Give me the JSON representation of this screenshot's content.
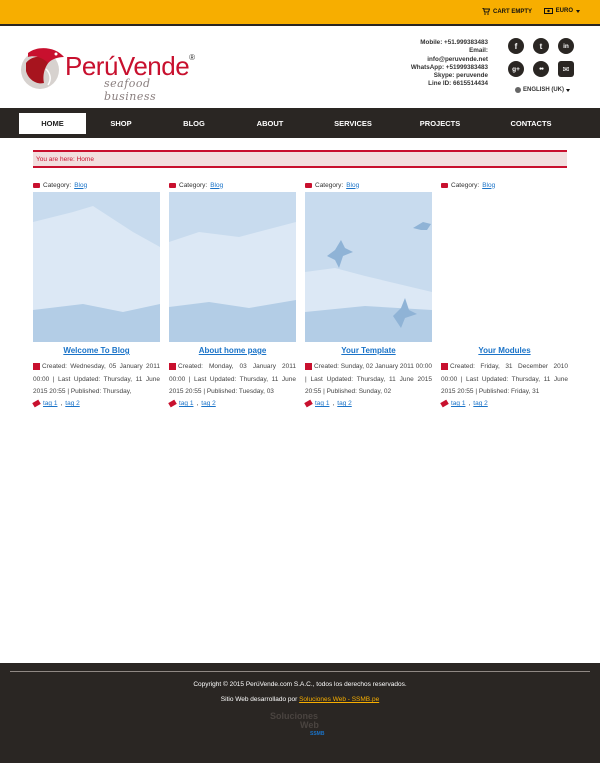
{
  "topbar": {
    "cart_label": "CART EMPTY",
    "currency_label": "EURO"
  },
  "brand": {
    "name": "PerúVende",
    "registered": "®",
    "tagline": "seafood business"
  },
  "contact": {
    "mobile": "Mobile: +51.999383483",
    "email_label": "Email:",
    "email": "info@peruvende.net",
    "whatsapp": "WhatsApp: +51999383483",
    "skype": "Skype: peruvende",
    "line": "Line ID: 6615514434"
  },
  "social": [
    "f",
    "t",
    "in",
    "g+",
    "●●",
    "✉"
  ],
  "language": "ENGLISH (UK)",
  "nav": [
    "HOME",
    "SHOP",
    "BLOG",
    "ABOUT",
    "SERVICES",
    "PROJECTS",
    "CONTACTS"
  ],
  "breadcrumb": "You are here: Home",
  "articles": [
    {
      "category_label": "Category:",
      "category": "Blog",
      "title": "Welcome To Blog",
      "meta": "Created: Wednesday, 05 January 2011 00:00 | Last Updated: Thursday, 11 June 2015 20:55 | Published: Thursday,",
      "tag1": "tag 1",
      "tag2": "tag 2"
    },
    {
      "category_label": "Category:",
      "category": "Blog",
      "title": "About home page",
      "meta": "Created: Monday, 03 January 2011 00:00 | Last Updated: Thursday, 11 June 2015 20:55 | Published: Tuesday, 03",
      "tag1": "tag 1",
      "tag2": "tag 2"
    },
    {
      "category_label": "Category:",
      "category": "Blog",
      "title": "Your Template",
      "meta": "Created: Sunday, 02 January 2011 00:00 | Last Updated: Thursday, 11 June 2015 20:55 | Published: Sunday, 02",
      "tag1": "tag 1",
      "tag2": "tag 2"
    },
    {
      "category_label": "Category:",
      "category": "Blog",
      "title": "Your Modules",
      "meta": "Created: Friday, 31 December 2010 00:00 | Last Updated: Thursday, 11 June 2015 20:55 | Published: Friday, 31",
      "tag1": "tag 1",
      "tag2": "tag 2"
    }
  ],
  "footer": {
    "copyright": "Copyright © 2015 PerúVende.com S.A.C., todos los derechos reservados.",
    "dev_prefix": "Sitio Web desarrollado por ",
    "dev_link": "Soluciones Web - SSMB.pe",
    "logo_line1": "Soluciones",
    "logo_line2": "Web",
    "logo_line3": "SSMB"
  },
  "colors": {
    "accent": "#f7ae00",
    "dark": "#2a2623",
    "brand_red": "#c8102e",
    "link": "#1a73c8"
  }
}
